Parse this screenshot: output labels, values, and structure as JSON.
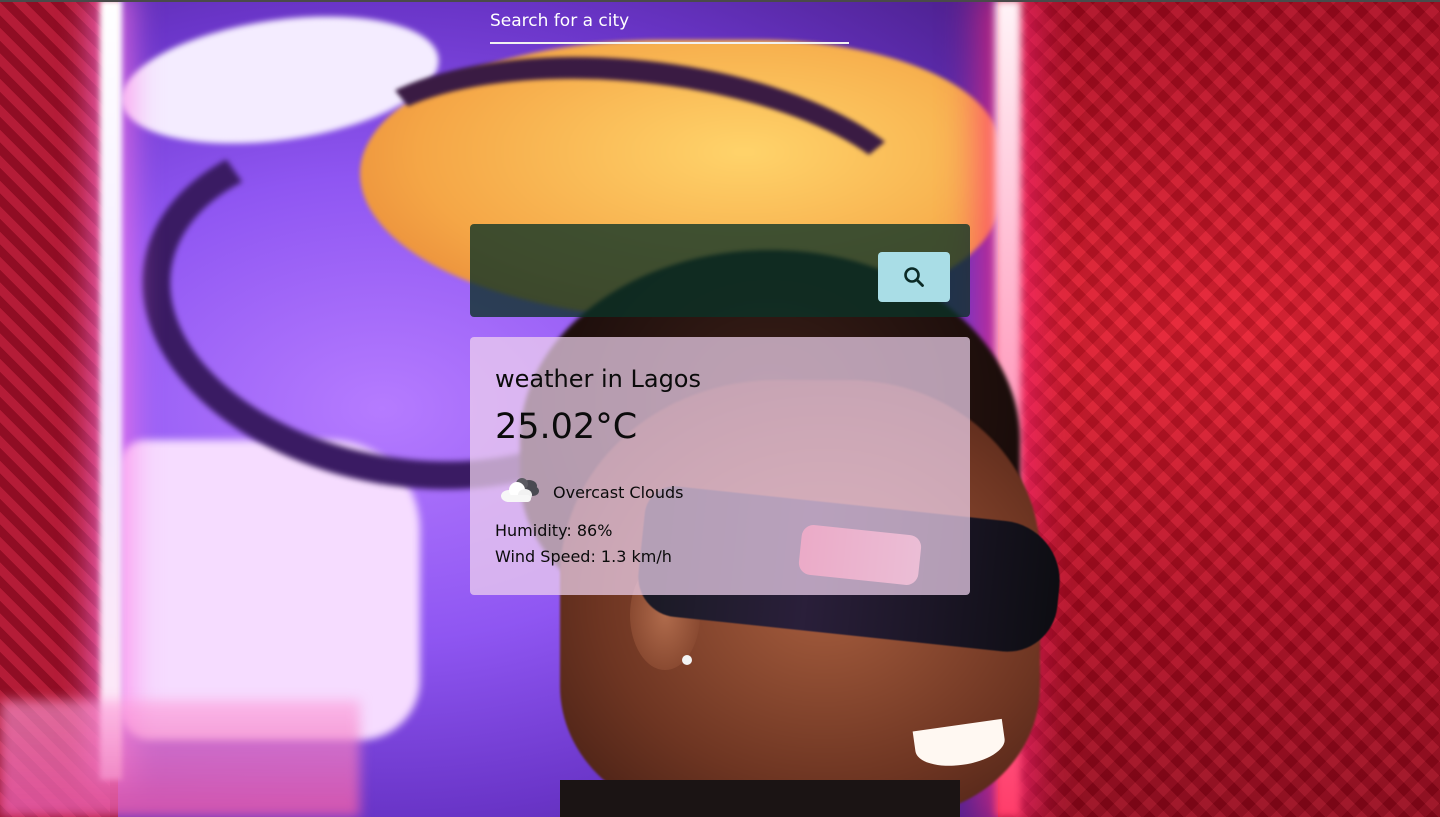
{
  "search": {
    "placeholder": "Search for a city",
    "button_icon": "search-icon"
  },
  "weather": {
    "title": "weather in Lagos",
    "temperature": "25.02°C",
    "condition_icon": "cloud-icon",
    "description": "Overcast Clouds",
    "humidity": "Humidity: 86%",
    "wind": "Wind Speed: 1.3 km/h"
  },
  "colors": {
    "search_panel": "#0a3226",
    "search_button": "#a9dde6",
    "card": "#f0d2ee"
  }
}
